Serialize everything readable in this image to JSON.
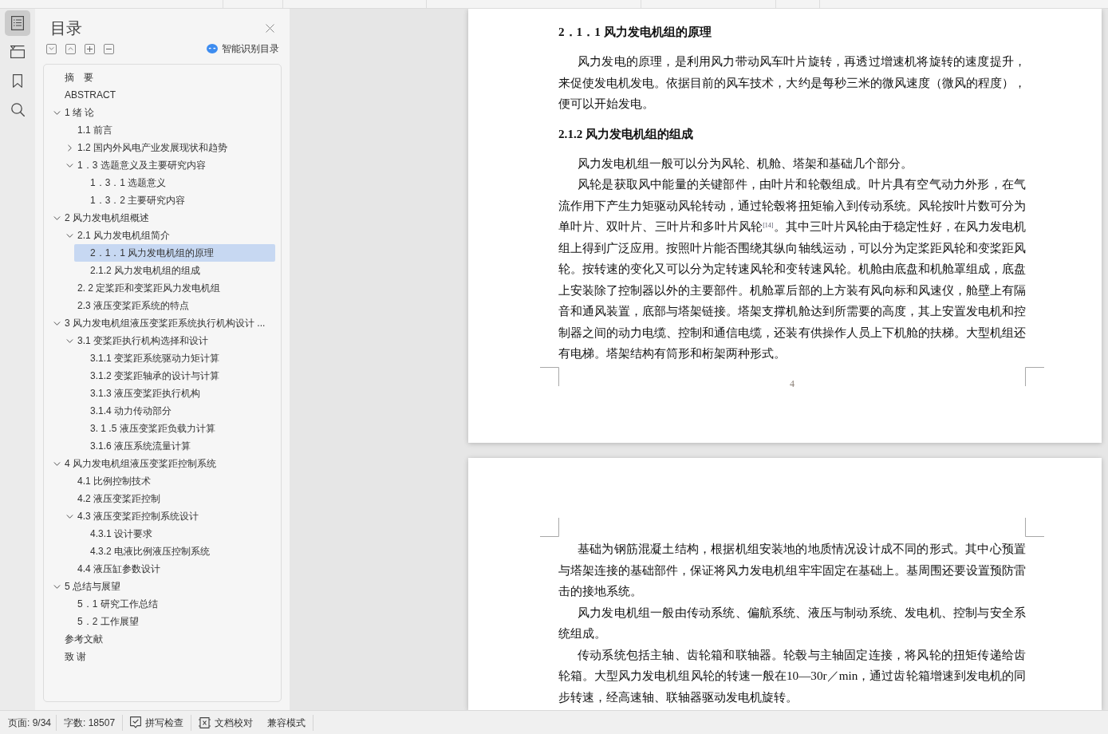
{
  "side_rail": {
    "tabs": [
      {
        "selected": true
      },
      {
        "selected": false
      },
      {
        "selected": false
      },
      {
        "selected": false
      }
    ]
  },
  "toc_panel": {
    "title": "目录",
    "smart_button": "智能识别目录",
    "items": [
      {
        "label": "摘　要",
        "selected": false
      },
      {
        "label": "ABSTRACT",
        "selected": false
      },
      {
        "label": "1 绪 论",
        "selected": false,
        "expanded": true,
        "children": [
          {
            "label": "1.1 前言",
            "selected": false
          },
          {
            "label": "1.2 国内外风电产业发展现状和趋势",
            "selected": false,
            "expanded": false
          },
          {
            "label": "1．3 选题意义及主要研究内容",
            "selected": false,
            "expanded": true,
            "children": [
              {
                "label": "1．3．1 选题意义",
                "selected": false
              },
              {
                "label": "1．3．2 主要研究内容",
                "selected": false
              }
            ]
          }
        ]
      },
      {
        "label": "2 风力发电机组概述",
        "selected": false,
        "expanded": true,
        "children": [
          {
            "label": "2.1 风力发电机组简介",
            "selected": false,
            "expanded": true,
            "children": [
              {
                "label": "2．1．1 风力发电机组的原理",
                "selected": true
              },
              {
                "label": "2.1.2 风力发电机组的组成",
                "selected": false
              }
            ]
          },
          {
            "label": "2. 2 定桨距和变桨距风力发电机组",
            "selected": false
          },
          {
            "label": "2.3 液压变桨距系统的特点",
            "selected": false
          }
        ]
      },
      {
        "label": "3 风力发电机组液压变桨距系统执行机构设计 ...",
        "selected": false,
        "expanded": true,
        "children": [
          {
            "label": "3.1 变桨距执行机构选择和设计",
            "selected": false,
            "expanded": true,
            "children": [
              {
                "label": "3.1.1 变桨距系统驱动力矩计算",
                "selected": false
              },
              {
                "label": "3.1.2 变桨距轴承的设计与计算",
                "selected": false
              },
              {
                "label": "3.1.3 液压变桨距执行机构",
                "selected": false
              },
              {
                "label": "3.1.4 动力传动部分",
                "selected": false
              },
              {
                "label": "3. 1 .5 液压变桨距负载力计算",
                "selected": false
              },
              {
                "label": "3.1.6 液压系统流量计算",
                "selected": false
              }
            ]
          }
        ]
      },
      {
        "label": "4 风力发电机组液压变桨距控制系统",
        "selected": false,
        "expanded": true,
        "children": [
          {
            "label": "4.1 比例控制技术",
            "selected": false
          },
          {
            "label": "4.2 液压变桨距控制",
            "selected": false
          },
          {
            "label": "4.3 液压变桨距控制系统设计",
            "selected": false,
            "expanded": true,
            "children": [
              {
                "label": "4.3.1 设计要求",
                "selected": false
              },
              {
                "label": "4.3.2 电液比例液压控制系统",
                "selected": false
              }
            ]
          },
          {
            "label": "4.4 液压缸参数设计",
            "selected": false
          }
        ]
      },
      {
        "label": "5 总结与展望",
        "selected": false,
        "expanded": true,
        "children": [
          {
            "label": "5．1 研究工作总结",
            "selected": false
          },
          {
            "label": "5．2 工作展望",
            "selected": false
          }
        ]
      },
      {
        "label": "参考文献",
        "selected": false
      },
      {
        "label": "致 谢",
        "selected": false
      }
    ]
  },
  "document": {
    "pages": [
      {
        "blocks": [
          {
            "kind": "heading",
            "text": "2．1．1 风力发电机组的原理"
          },
          {
            "kind": "paragraph",
            "text": "风力发电的原理，是利用风力带动风车叶片旋转，再透过增速机将旋转的速度提升，来促使发电机发电。依据目前的风车技术，大约是每秒三米的微风速度（微风的程度），便可以开始发电。"
          },
          {
            "kind": "heading",
            "text": "2.1.2 风力发电机组的组成"
          },
          {
            "kind": "paragraph",
            "text": "风力发电机组一般可以分为风轮、机舱、塔架和基础几个部分。"
          },
          {
            "kind": "paragraph",
            "text": "风轮是获取风中能量的关键部件，由叶片和轮毂组成。叶片具有空气动力外形，在气流作用下产生力矩驱动风轮转动，通过轮毂将扭矩输入到传动系统。风轮按叶片数可分为单叶片、双叶片、三叶片和多叶片风轮$^{[14]}$。其中三叶片风轮由于稳定性好，在风力发电机组上得到广泛应用。按照叶片能否围绕其纵向轴线运动，可以分为定桨距风轮和变桨距风轮。按转速的变化又可以分为定转速风轮和变转速风轮。机舱由底盘和机舱罩组成，底盘上安装除了控制器以外的主要部件。机舱罩后部的上方装有风向标和风速仪，舱壁上有隔音和通风装置，底部与塔架链接。塔架支撑机舱达到所需要的高度，其上安置发电机和控制器之间的动力电缆、控制和通信电缆，还装有供操作人员上下机舱的扶梯。大型机组还有电梯。塔架结构有筒形和桁架两种形式。"
          }
        ],
        "page_number": "4"
      },
      {
        "blocks": [
          {
            "kind": "paragraph",
            "text": "基础为钢筋混凝土结构，根据机组安装地的地质情况设计成不同的形式。其中心预置与塔架连接的基础部件，保证将风力发电机组牢牢固定在基础上。基周围还要设置预防雷击的接地系统。"
          },
          {
            "kind": "paragraph",
            "text": "风力发电机组一般由传动系统、偏航系统、液压与制动系统、发电机、控制与安全系统组成。"
          },
          {
            "kind": "paragraph",
            "text": "传动系统包括主轴、齿轮箱和联轴器。轮毂与主轴固定连接，将风轮的扭矩传递给齿轮箱。大型风力发电机组风轮的转速一般在10—30r／min，通过齿轮箱增速到发电机的同步转速，经高速轴、联轴器驱动发电机旋转。"
          }
        ]
      }
    ]
  },
  "status_bar": {
    "page": "页面: 9/34",
    "word_count": "字数: 18507",
    "tools": [
      "拼写检查",
      "文档校对",
      "兼容模式"
    ]
  }
}
